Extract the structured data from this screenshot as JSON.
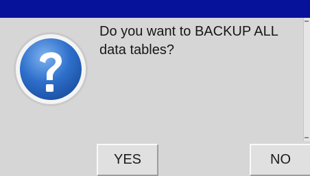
{
  "dialog": {
    "message": "Do you want to BACKUP ALL data tables?",
    "icon": "question-icon",
    "buttons": {
      "yes_label": "YES",
      "no_label": "NO"
    }
  },
  "colors": {
    "titlebar": "#07129a",
    "background": "#d6d6d6",
    "icon_blue": "#2a68c4"
  }
}
